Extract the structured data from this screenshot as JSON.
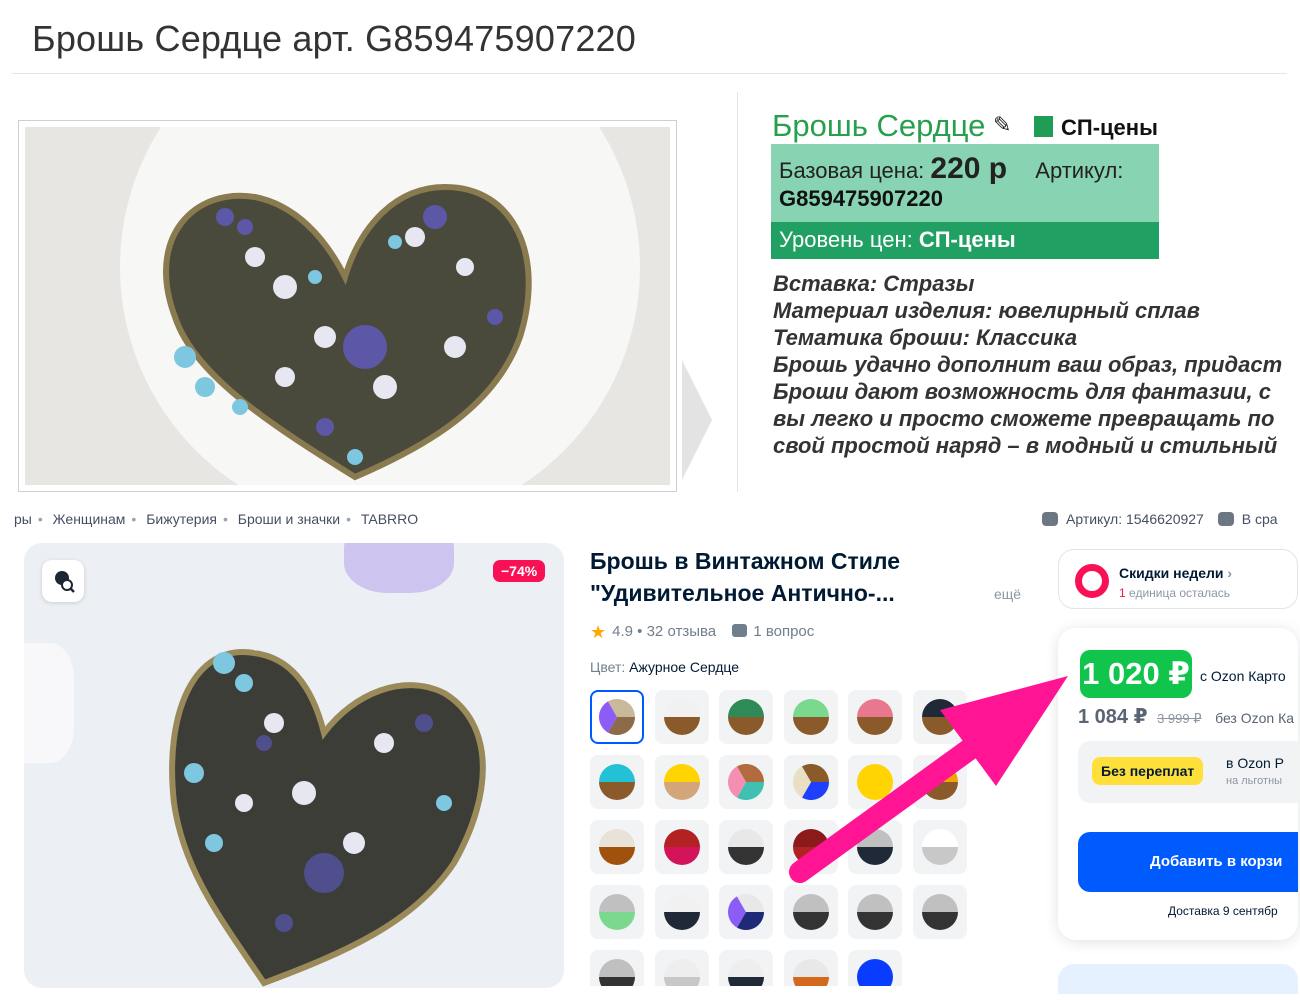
{
  "sp": {
    "page_title": "Брошь Сердце арт. G859475907220",
    "product_name": "Брошь Сердце",
    "edit_glyph": "✎",
    "price_tag": "СП-цены",
    "base_price_label": "Базовая цена:",
    "base_price": "220 р",
    "sku_label": "Артикул:",
    "sku": "G859475907220",
    "price_level_label": "Уровень цен:",
    "price_level": "СП-цены",
    "description": [
      "Вставка: Стразы",
      "Материал изделия: ювелирный сплав",
      "Тематика броши: Классика",
      "Брошь удачно дополнит ваш образ, придаст",
      "Броши дают возможность для фантазии, с",
      "вы легко и просто сможете превращать по",
      "свой простой наряд – в модный и стильный"
    ],
    "colors": {
      "name_green": "#27a04d",
      "price_box": "#88d4b2",
      "level_box": "#21a064"
    }
  },
  "ozon": {
    "breadcrumbs": [
      "ры",
      "Женщинам",
      "Бижутерия",
      "Броши и значки",
      "TABRRO"
    ],
    "sku_text": "Артикул: 1546620927",
    "compare_text": "В сра",
    "discount_badge": "−74%",
    "title": "Брошь в Винтажном Стиле \"Удивительное Антично-...",
    "more_link": "ещё",
    "rating": "4.9",
    "reviews": "32 отзыва",
    "questions": "1 вопрос",
    "color_label": "Цвет:",
    "color_value": "Ажурное Сердце",
    "promo_title": "Скидки недели",
    "promo_chevron": "›",
    "promo_sub_count": "1",
    "promo_sub_rest": "единица осталась",
    "card_price": "1 020 ₽",
    "card_price_suffix": "с Ozon Карто",
    "price_no_card": "1 084 ₽",
    "old_price": "3 999 ₽",
    "no_card_label": "без Ozon Ка",
    "no_overpay_button": "Без переплат",
    "no_overpay_line1": "в Ozon Р",
    "no_overpay_line2": "на льготны",
    "add_to_cart": "Добавить в корзи",
    "delivery": "Доставка 9 сентябр",
    "colors": {
      "accent_blue": "#005bff",
      "price_green": "#10c44c",
      "sale_red": "#f91155",
      "arrow_magenta": "#ff1493"
    },
    "swatches": [
      [
        "#8b6b4a",
        "#8b5cf6",
        "#c8b99a"
      ],
      [
        "#8b5a2b",
        "#f1f1f1"
      ],
      [
        "#8b5a2b",
        "#2e8b57"
      ],
      [
        "#8b5a2b",
        "#7bd88f"
      ],
      [
        "#8b5a2b",
        "#e9788e"
      ],
      [
        "#8b5a2b",
        "#1f2937"
      ],
      [
        "#8b5a2b",
        "#22c1d6"
      ],
      [
        "#d2a679",
        "#ffd400"
      ],
      [
        "#40c0b0",
        "#f48fb1",
        "#b26b3c"
      ],
      [
        "#1f3fff",
        "#e9dfc2",
        "#8b5a2b"
      ],
      [
        "#ffd400",
        "#ffd400"
      ],
      [
        "#8b5a2b",
        "#f0a500"
      ],
      [
        "#a0520d",
        "#e8e2d8"
      ],
      [
        "#d4145a",
        "#b22222"
      ],
      [
        "#333333",
        "#e8e8e8"
      ],
      [
        "#b22222",
        "#8b1a1a"
      ],
      [
        "#1f2937",
        "#c0c0c0"
      ],
      [
        "#c8c8c8",
        "#ffffff"
      ],
      [
        "#7bd88f",
        "#c0c0c0"
      ],
      [
        "#1f2937",
        "#f1f1f1"
      ],
      [
        "#1e2a78",
        "#8b5cf6",
        "#e8e8e8"
      ],
      [
        "#333333",
        "#c0c0c0"
      ],
      [
        "#333333",
        "#c0c0c0"
      ],
      [
        "#333333",
        "#c0c0c0"
      ],
      [
        "#333333",
        "#c0c0c0"
      ],
      [
        "#c8c8c8",
        "#eeeeee"
      ],
      [
        "#1f2937",
        "#eeeeee"
      ],
      [
        "#d2691e",
        "#e8e8e8"
      ],
      [
        "#0a3cff",
        "#0a3cff"
      ]
    ]
  }
}
